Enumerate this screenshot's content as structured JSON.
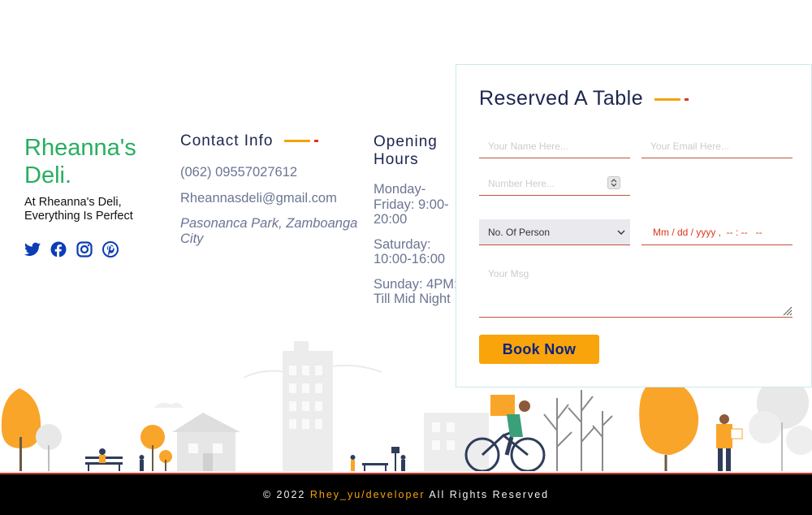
{
  "brand": {
    "name": "Rheanna's Deli.",
    "tagline": "At Rheanna's Deli, Everything Is Perfect",
    "color": "#27ae60",
    "socials": [
      "twitter-icon",
      "facebook-icon",
      "instagram-icon",
      "pinterest-icon"
    ]
  },
  "contact": {
    "title": "Contact Info",
    "phone": "(062) 09557027612",
    "email": "Rheannasdeli@gmail.com",
    "address": "Pasonanca Park, Zamboanga City"
  },
  "hours": {
    "title": "Opening Hours",
    "slots": [
      "Monday-Friday: 9:00-20:00",
      "Saturday: 10:00-16:00",
      "Sunday: 4PM: Till Mid Night"
    ]
  },
  "reservation": {
    "title": "Reserved A Table",
    "name_placeholder": "Your Name Here...",
    "email_placeholder": "Your Email Here...",
    "number_placeholder": "Number Here...",
    "persons_selected": "No. Of Person",
    "date_placeholder": "Mm / dd / yyyy ,  -- : --   --",
    "msg_placeholder": "Your Msg",
    "button_label": "Book Now"
  },
  "footer": {
    "prefix": "© 2022 ",
    "developer": "Rhey_yu/developer",
    "suffix": " All Rights Reserved"
  },
  "colors": {
    "accent": "#f5a20a",
    "heading": "#1b2550",
    "muted": "#6b7593",
    "underline": "#c0523d"
  }
}
